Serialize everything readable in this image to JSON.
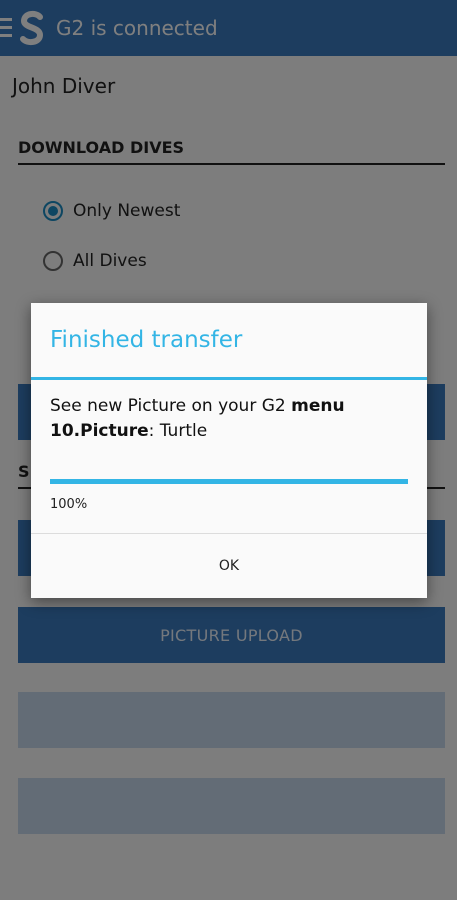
{
  "appbar": {
    "title": "G2 is connected",
    "background": "#3a7bbf"
  },
  "user": {
    "name": "John Diver"
  },
  "download": {
    "header": "DOWNLOAD DIVES",
    "options": [
      {
        "label": "Only Newest",
        "checked": true
      },
      {
        "label": "All Dives",
        "checked": false
      }
    ]
  },
  "buttons": {
    "picture_upload": "PICTURE UPLOAD",
    "disabled_button_1": "",
    "disabled_button_2": ""
  },
  "dialog": {
    "title": "Finished transfer",
    "message_prefix": "See new Picture on your G2 ",
    "message_bold_1": "menu",
    "message_bold_2": "10.Picture",
    "message_suffix": ": Turtle",
    "progress": 1.0,
    "progress_text": "100%",
    "ok_label": "OK",
    "accent": "#33b5e5"
  }
}
